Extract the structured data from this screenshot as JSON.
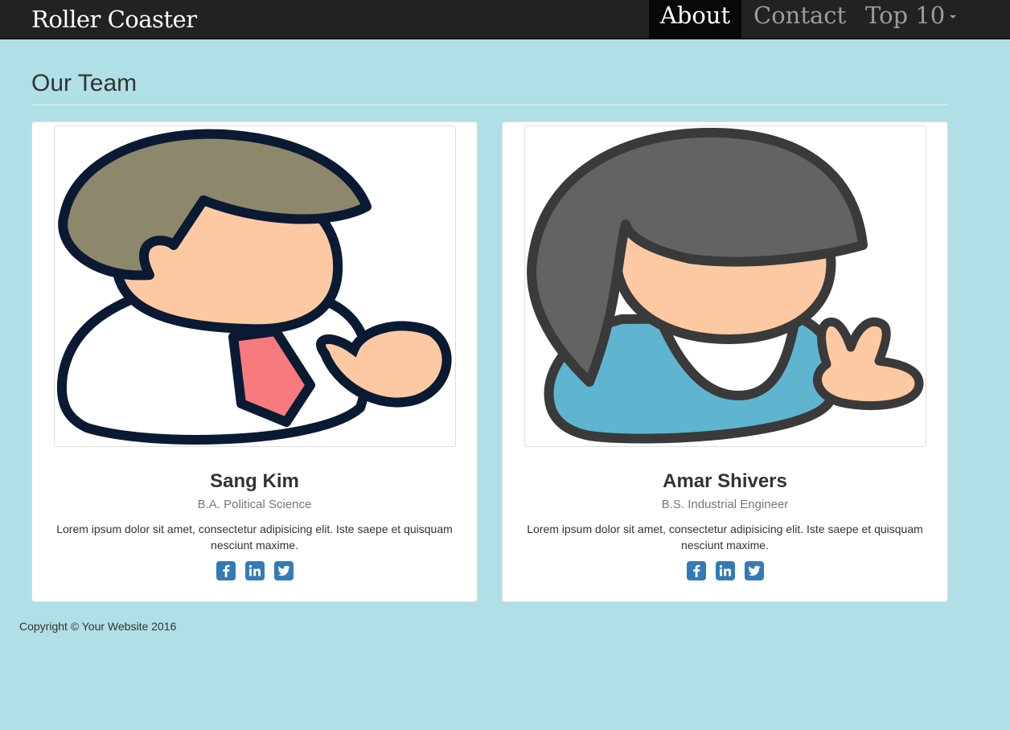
{
  "nav": {
    "brand": "Roller Coaster",
    "items": [
      {
        "label": "About",
        "active": true
      },
      {
        "label": "Contact"
      },
      {
        "label": "Top 10",
        "dropdown": true
      }
    ]
  },
  "page": {
    "title": "Our Team"
  },
  "team": [
    {
      "name": "Sang Kim",
      "degree": "B.A. Political Science",
      "bio": "Lorem ipsum dolor sit amet, consectetur adipisicing elit. Iste saepe et quisquam nesciunt maxime.",
      "avatar_icon": "businessman-avatar",
      "socials": [
        "facebook-icon",
        "linkedin-icon",
        "twitter-icon"
      ]
    },
    {
      "name": "Amar Shivers",
      "degree": "B.S. Industrial Engineer",
      "bio": "Lorem ipsum dolor sit amet, consectetur adipisicing elit. Iste saepe et quisquam nesciunt maxime.",
      "avatar_icon": "peace-sign-avatar",
      "socials": [
        "facebook-icon",
        "linkedin-icon",
        "twitter-icon"
      ]
    }
  ],
  "footer": {
    "copyright": "Copyright © Your Website 2016"
  },
  "colors": {
    "page_bg": "#b0dfe5",
    "navbar_bg": "#222222",
    "social_blue": "#337ab7"
  }
}
